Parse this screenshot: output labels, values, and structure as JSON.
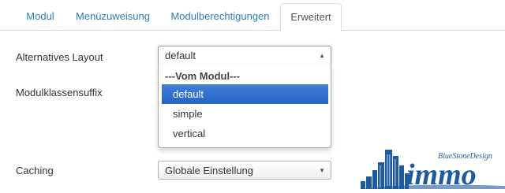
{
  "tabs": [
    {
      "label": "Modul",
      "active": false
    },
    {
      "label": "Menüzuweisung",
      "active": false
    },
    {
      "label": "Modulberechtigungen",
      "active": false
    },
    {
      "label": "Erweitert",
      "active": true
    }
  ],
  "fields": {
    "layout_label": "Alternatives Layout",
    "layout_value": "default",
    "suffix_label": "Modulklassensuffix",
    "caching_label": "Caching",
    "caching_value": "Globale Einstellung"
  },
  "layout_dropdown": {
    "group_label": "---Vom Modul---",
    "options": [
      "default",
      "simple",
      "vertical"
    ],
    "highlighted": "default"
  },
  "logo": {
    "text": "immo",
    "tagline": "BlueStoneDesign",
    "color": "#1e5a9e"
  },
  "icons": {
    "select_open": "triangle-up",
    "select_closed": "triangle-down"
  }
}
